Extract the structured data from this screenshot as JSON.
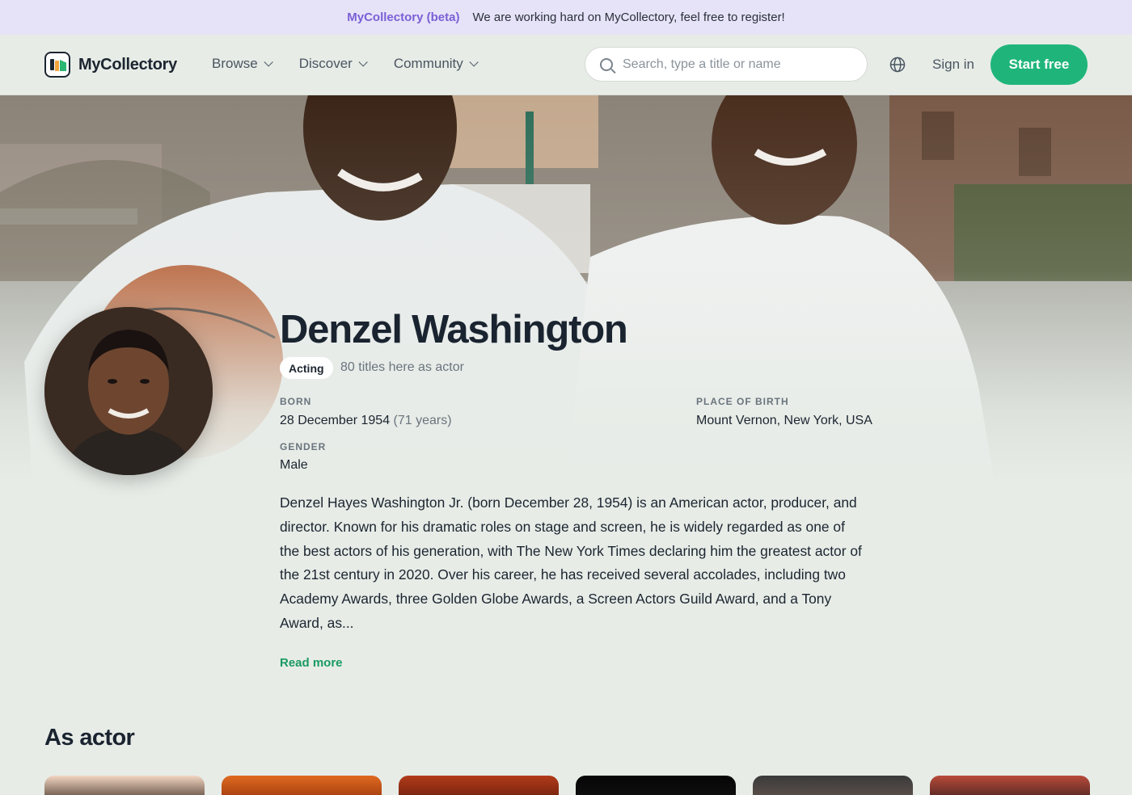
{
  "announcement": {
    "brand": "MyCollectory (beta)",
    "message": "We are working hard on MyCollectory, feel free to register!"
  },
  "header": {
    "logo_text": "MyCollectory",
    "nav": [
      {
        "label": "Browse"
      },
      {
        "label": "Discover"
      },
      {
        "label": "Community"
      }
    ],
    "search_placeholder": "Search, type a title or name",
    "signin_label": "Sign in",
    "start_label": "Start free",
    "icons": [
      "search-icon",
      "globe-icon",
      "chevron-down-icon"
    ]
  },
  "person": {
    "name": "Denzel Washington",
    "department_badge": "Acting",
    "titles_count_text": "80 titles here as actor",
    "born_label": "BORN",
    "born_value": "28 December 1954",
    "age_text": "(71 years)",
    "place_label": "PLACE OF BIRTH",
    "place_value": "Mount Vernon, New York, USA",
    "gender_label": "GENDER",
    "gender_value": "Male",
    "bio": "Denzel Hayes Washington Jr. (born December 28, 1954) is an American actor, producer, and director. Known for his dramatic roles on stage and screen, he is widely regarded as one of the best actors of his generation, with The New York Times declaring him the greatest actor of the 21st century in 2020. Over his career, he has received several accolades, including two Academy Awards, three Golden Globe Awards, a Screen Actors Guild Award, and a Tony Award, as...",
    "read_more": "Read more"
  },
  "filmography": {
    "section_title": "As actor",
    "posters": [
      {
        "color_top": "#f3d6c2",
        "color_bottom": "#2a1a12"
      },
      {
        "color_top": "#e06a20",
        "color_bottom": "#8a2a08"
      },
      {
        "color_top": "#b23a1a",
        "color_bottom": "#5a1a0a"
      },
      {
        "color_top": "#050505",
        "color_bottom": "#151515"
      },
      {
        "color_top": "#3a3a3a",
        "color_bottom": "#6a5a52"
      },
      {
        "color_top": "#b84a3a",
        "color_bottom": "#2a1a1a"
      }
    ]
  },
  "colors": {
    "accent": "#1fb57a",
    "brand_purple": "#7b5fd6",
    "announce_bg": "#e6e3f8",
    "page_bg": "#e7ece7"
  }
}
